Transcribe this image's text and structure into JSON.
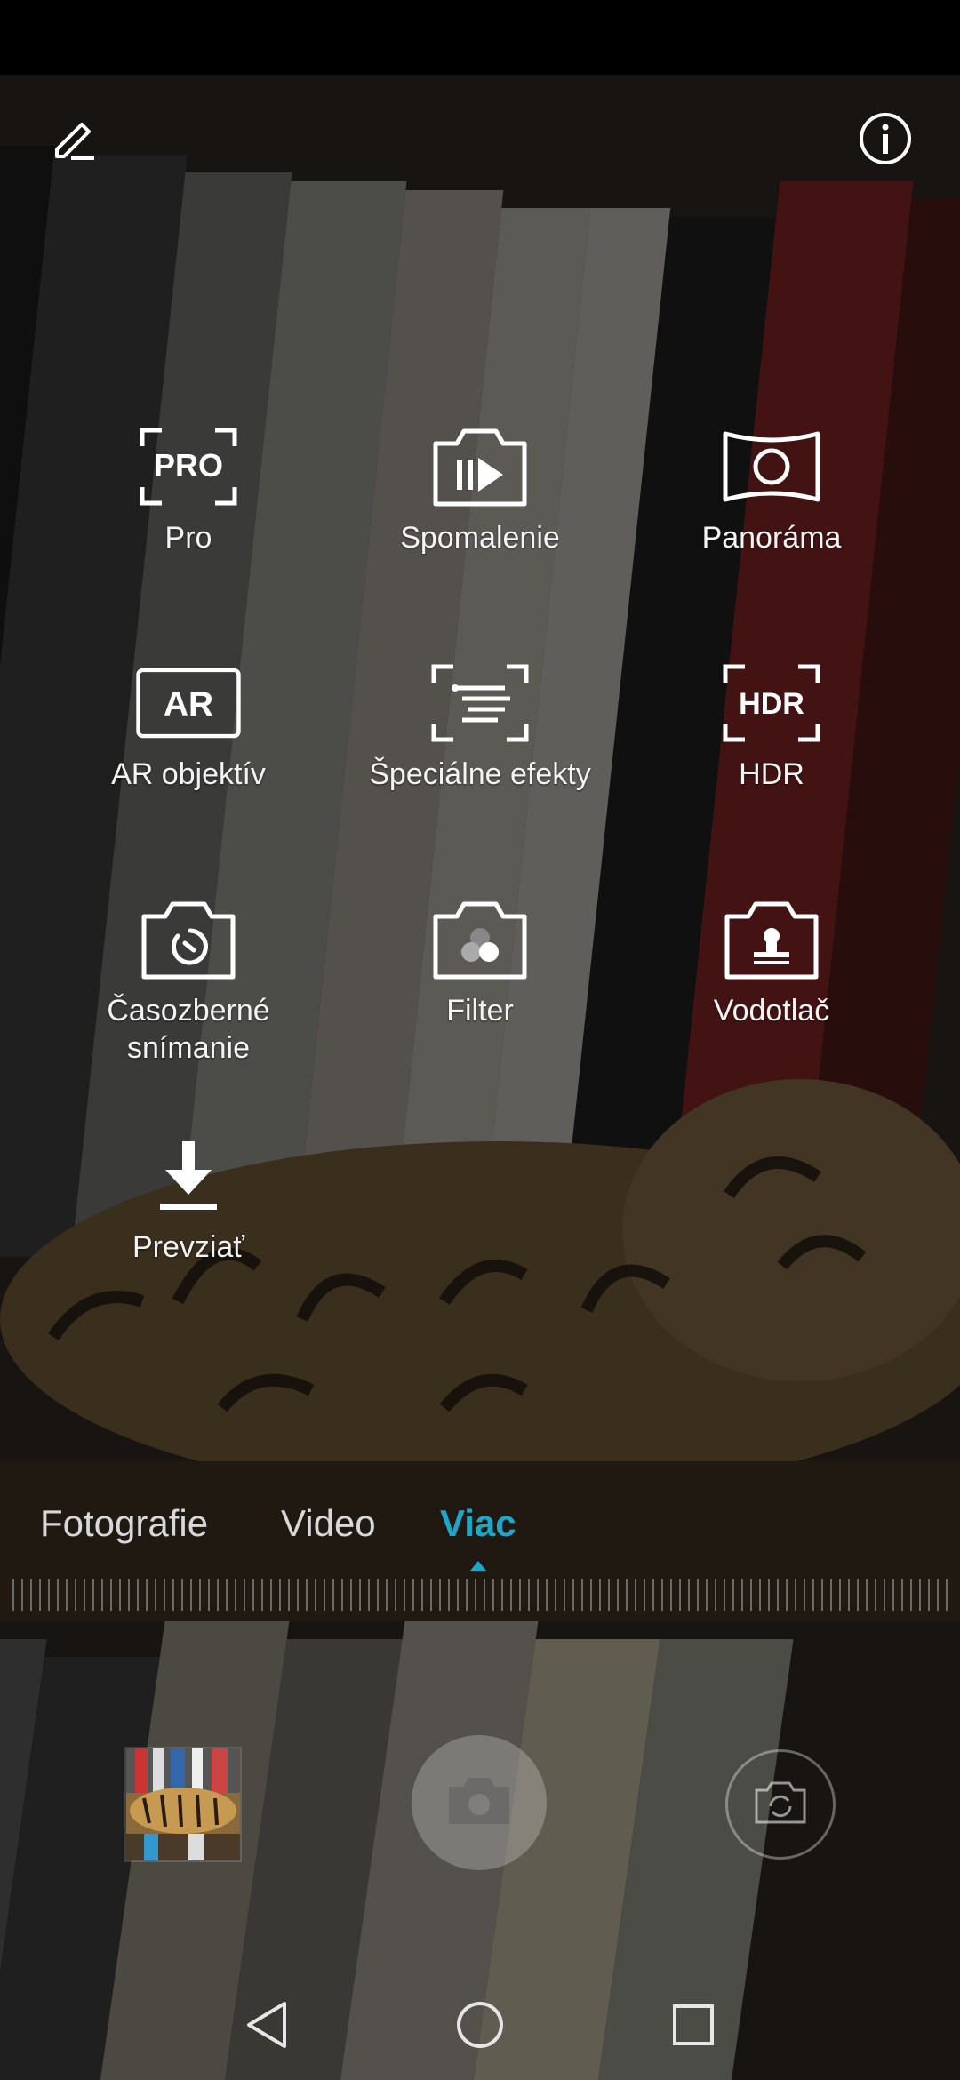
{
  "top_bar": {
    "edit_icon": "pencil-icon",
    "info_icon": "info-circle-icon"
  },
  "modes": [
    {
      "id": "pro",
      "label": "Pro",
      "icon": "pro-icon"
    },
    {
      "id": "slow-motion",
      "label": "Spomalenie",
      "icon": "slow-motion-icon"
    },
    {
      "id": "panorama",
      "label": "Panoráma",
      "icon": "panorama-icon"
    },
    {
      "id": "ar",
      "label": "AR objektív",
      "icon": "ar-icon"
    },
    {
      "id": "effects",
      "label": "Špeciálne efekty",
      "icon": "special-effects-icon"
    },
    {
      "id": "hdr",
      "label": "HDR",
      "icon": "hdr-icon"
    },
    {
      "id": "timelapse",
      "label": "Časozberné snímanie",
      "icon": "timelapse-icon"
    },
    {
      "id": "filter",
      "label": "Filter",
      "icon": "filter-icon"
    },
    {
      "id": "watermark",
      "label": "Vodotlač",
      "icon": "watermark-icon"
    },
    {
      "id": "download",
      "label": "Prevziať",
      "icon": "download-icon"
    }
  ],
  "tabs": [
    {
      "label": "Fotografie",
      "active": false
    },
    {
      "label": "Video",
      "active": false
    },
    {
      "label": "Viac",
      "active": true
    }
  ],
  "colors": {
    "accent": "#1fa7c9"
  },
  "bottom": {
    "gallery_icon": "gallery-thumbnail",
    "shutter_icon": "shutter-icon",
    "switch_icon": "switch-camera-icon"
  },
  "navigation": {
    "back_icon": "back-icon",
    "home_icon": "home-icon",
    "recents_icon": "recents-icon"
  }
}
